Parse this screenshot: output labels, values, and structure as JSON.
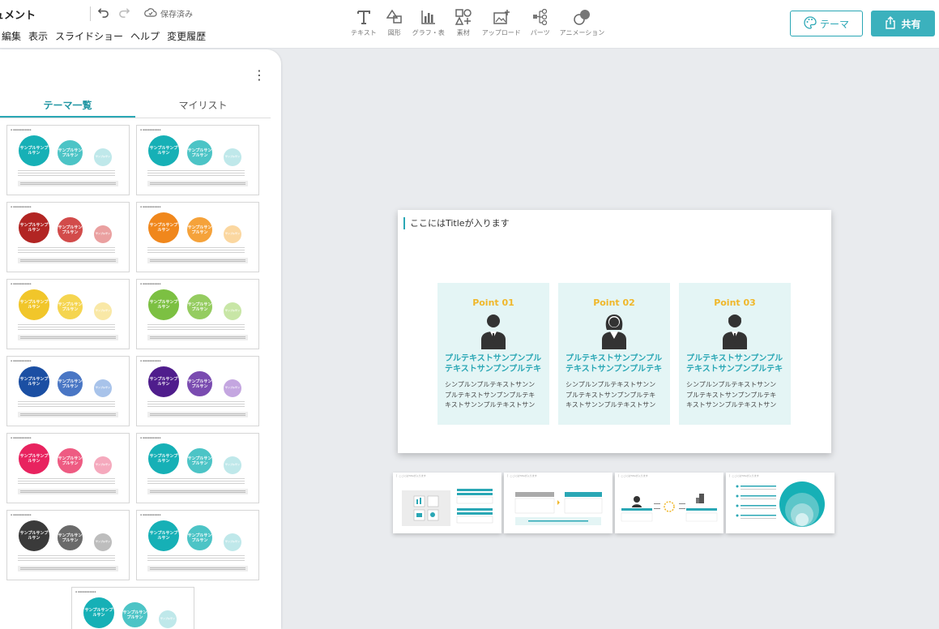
{
  "header": {
    "doc_title": "ュメント",
    "saved_label": "保存済み",
    "menu": [
      "編集",
      "表示",
      "スライドショー",
      "ヘルプ",
      "変更履歴"
    ],
    "tools": [
      {
        "label": "テキスト",
        "icon": "text-icon"
      },
      {
        "label": "図形",
        "icon": "shapes-icon"
      },
      {
        "label": "グラフ・表",
        "icon": "chart-icon"
      },
      {
        "label": "素材",
        "icon": "assets-icon"
      },
      {
        "label": "アップロード",
        "icon": "upload-icon"
      },
      {
        "label": "パーツ",
        "icon": "parts-icon"
      },
      {
        "label": "アニメーション",
        "icon": "animation-icon"
      }
    ],
    "theme_button": "テーマ",
    "share_button": "共有"
  },
  "panel": {
    "tabs": [
      "テーマ一覧",
      "マイリスト"
    ],
    "theme_circle_labels": [
      "サンプルサンプルサン",
      "サンプルサンプルサン",
      "サンプルサン"
    ],
    "themes": [
      {
        "c1": "#16b0b6",
        "c2": "#4cc4c6",
        "c3": "#bfe8ea"
      },
      {
        "c1": "#16b0b6",
        "c2": "#4cc4c6",
        "c3": "#bfe8ea"
      },
      {
        "c1": "#b22523",
        "c2": "#d24b4a",
        "c3": "#eaa0a0"
      },
      {
        "c1": "#f0871c",
        "c2": "#f5a23a",
        "c3": "#fbd7a0"
      },
      {
        "c1": "#f1c62a",
        "c2": "#f5d550",
        "c3": "#f9e8a6"
      },
      {
        "c1": "#7cc042",
        "c2": "#95cc60",
        "c3": "#c8e6a6"
      },
      {
        "c1": "#1b4fa3",
        "c2": "#4976c4",
        "c3": "#a8c3ea"
      },
      {
        "c1": "#4f1d8c",
        "c2": "#7a4bb0",
        "c3": "#c4a6e0"
      },
      {
        "c1": "#e8235f",
        "c2": "#ee5b82",
        "c3": "#f5a9bd"
      },
      {
        "c1": "#16b0b6",
        "c2": "#4cc4c6",
        "c3": "#bfe8ea"
      },
      {
        "c1": "#3a3a3a",
        "c2": "#6a6a6a",
        "c3": "#bdbdbd"
      },
      {
        "c1": "#16b0b6",
        "c2": "#4cc4c6",
        "c3": "#bfe8ea"
      },
      {
        "c1": "#16b0b6",
        "c2": "#4cc4c6",
        "c3": "#bfe8ea"
      }
    ]
  },
  "slide": {
    "title": "ここにはTitleが入ります",
    "cards": [
      {
        "point": "Point 01",
        "heading1": "プルテキストサンプンプル",
        "heading2": "テキストサンプンプルテキ",
        "body1": "シンプルンプルテキストサンン",
        "body2": "プルテキストサンプンプルテキ",
        "body3": "キストサンンプルテキストサン"
      },
      {
        "point": "Point 02",
        "heading1": "プルテキストサンプンプル",
        "heading2": "テキストサンプンプルテキ",
        "body1": "シンプルンプルテキストサンン",
        "body2": "プルテキストサンプンプルテキ",
        "body3": "キストサンンプルテキストサン"
      },
      {
        "point": "Point 03",
        "heading1": "プルテキストサンプンプル",
        "heading2": "テキストサンプンプルテキ",
        "body1": "シンプルンプルテキストサンン",
        "body2": "プルテキストサンプンプルテキ",
        "body3": "キストサンンプルテキストサン"
      }
    ]
  },
  "colors": {
    "accent": "#2aa7b5",
    "point": "#f0b72a",
    "card_bg": "#e4f5f5"
  }
}
